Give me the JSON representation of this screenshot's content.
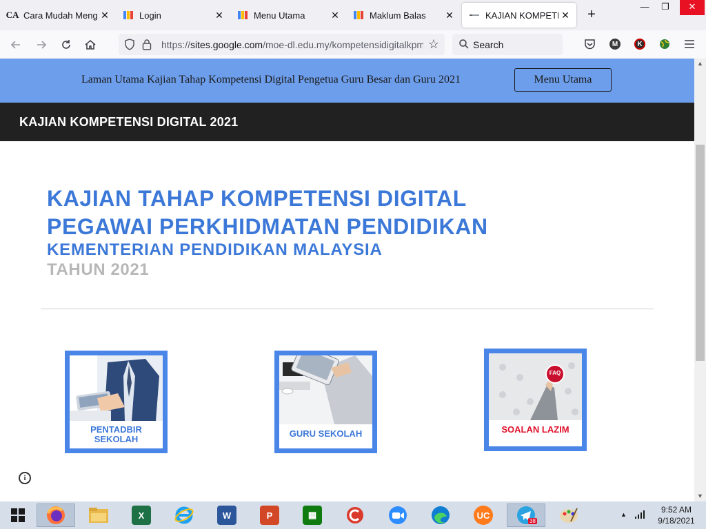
{
  "browser": {
    "tabs": [
      {
        "title": "Cara Mudah Mengisi",
        "favicon": "CA",
        "active": false
      },
      {
        "title": "Login",
        "favicon": "forms-icon",
        "active": false
      },
      {
        "title": "Menu Utama",
        "favicon": "forms-icon",
        "active": false
      },
      {
        "title": "Maklum Balas",
        "favicon": "forms-icon",
        "active": false
      },
      {
        "title": "KAJIAN KOMPETENS",
        "favicon": "sites-icon",
        "active": true
      }
    ],
    "new_tab_label": "+",
    "url_prefix": "https://",
    "url_domain": "sites.google.com",
    "url_path": "/moe-dl.edu.my/kompetensidigitalkpm",
    "search_placeholder": "Search",
    "extensions": [
      {
        "letter": "M",
        "color": "#3a3a3a"
      },
      {
        "letter": "K",
        "color": "#2b2b2b"
      }
    ]
  },
  "page": {
    "announcement": "Laman Utama Kajian Tahap Kompetensi Digital Pengetua Guru Besar dan Guru 2021",
    "menu_button": "Menu Utama",
    "site_title": "KAJIAN KOMPETENSI DIGITAL 2021",
    "heading_line1": "KAJIAN TAHAP KOMPETENSI DIGITAL",
    "heading_line2": "PEGAWAI PERKHIDMATAN PENDIDIKAN",
    "heading_line3": "KEMENTERIAN PENDIDIKAN MALAYSIA",
    "heading_line4": "TAHUN 2021",
    "cards": [
      {
        "label_line1": "PENTADBIR",
        "label_line2": "SEKOLAH",
        "color": "#3c78d8"
      },
      {
        "label_line1": "GURU SEKOLAH",
        "label_line2": "",
        "color": "#3c78d8"
      },
      {
        "label_line1": "SOALAN LAZIM",
        "label_line2": "",
        "color": "#e0102a",
        "badge": "FAQ"
      }
    ],
    "info_icon": "i"
  },
  "colors": {
    "announcement_bg": "#6d9eeb",
    "site_bar_bg": "#212121",
    "heading_blue": "#3c78d8",
    "heading_grey": "#b7b7b7"
  },
  "taskbar": {
    "time": "9:52 AM",
    "date": "9/18/2021",
    "telegram_badge": "38",
    "apps": [
      "start",
      "firefox",
      "file-explorer",
      "excel",
      "internet-explorer",
      "word",
      "powerpoint",
      "store",
      "cc-cleaner",
      "zoom",
      "edge",
      "uc-browser",
      "telegram",
      "paint"
    ]
  }
}
